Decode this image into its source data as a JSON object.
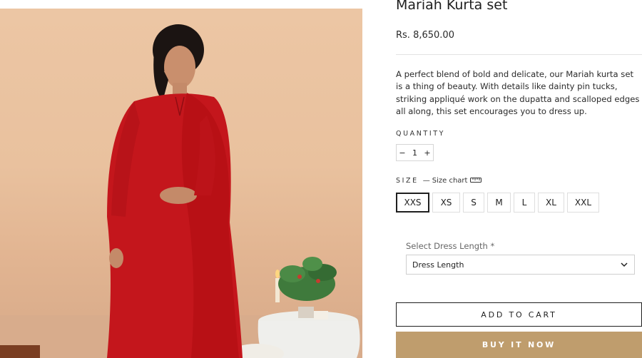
{
  "product": {
    "title": "Mariah Kurta set",
    "price": "Rs. 8,650.00",
    "description": "A perfect blend of bold and delicate, our Mariah kurta set is a thing of beauty. With details like dainty pin tucks, striking appliqué work on the dupatta and scalloped edges all along, this set encourages you to dress up."
  },
  "quantity": {
    "label": "QUANTITY",
    "minus": "−",
    "value": "1",
    "plus": "+"
  },
  "size": {
    "label": "SIZE",
    "chart_dash": "—",
    "chart_link": "Size chart",
    "options": [
      "XXS",
      "XS",
      "S",
      "M",
      "L",
      "XL",
      "XXL"
    ],
    "selected": "XXS"
  },
  "length": {
    "label": "Select Dress Length *",
    "selected": "Dress Length"
  },
  "actions": {
    "add_to_cart": "ADD TO CART",
    "buy_now": "BUY IT NOW"
  },
  "colors": {
    "buy_button": "#bf9d6d",
    "kurta_red": "#c4161c",
    "background_wall": "#e9c19e"
  },
  "icons": {
    "size_chart": "ruler-icon",
    "dropdown": "chevron-down-icon"
  }
}
